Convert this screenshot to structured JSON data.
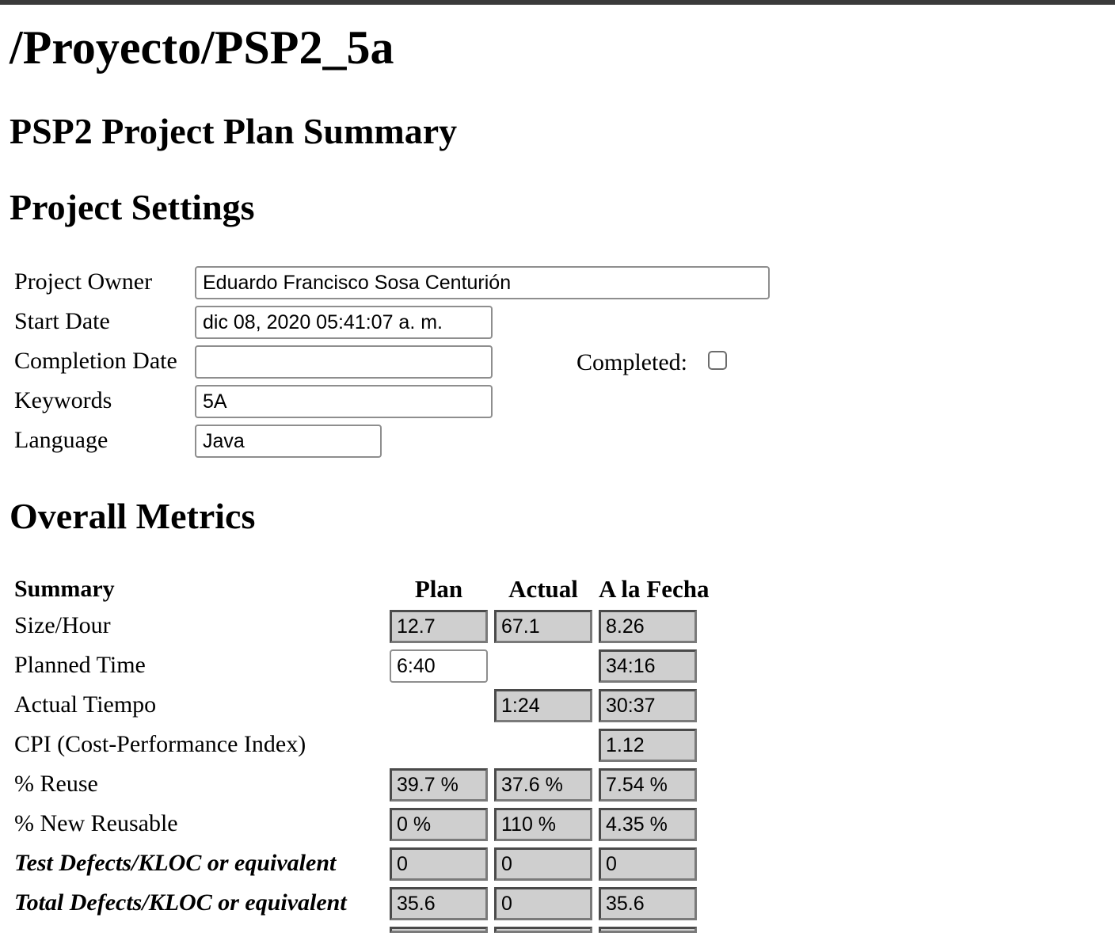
{
  "page": {
    "path_title": "/Proyecto/PSP2_5a",
    "subtitle": "PSP2 Project Plan Summary",
    "settings_heading": "Project Settings",
    "metrics_heading": "Overall Metrics"
  },
  "settings": {
    "owner_label": "Project Owner",
    "owner_value": "Eduardo Francisco Sosa Centurión",
    "start_label": "Start Date",
    "start_value": "dic 08, 2020 05:41:07 a. m.",
    "completion_label": "Completion Date",
    "completion_value": "",
    "completed_label": "Completed:",
    "completed_checked": false,
    "keywords_label": "Keywords",
    "keywords_value": "5A",
    "language_label": "Language",
    "language_value": "Java"
  },
  "metrics": {
    "headers": {
      "summary": "Summary",
      "plan": "Plan",
      "actual": "Actual",
      "to_date": "A la Fecha"
    },
    "rows": [
      {
        "label": "Size/Hour",
        "plan": "12.7",
        "actual": "67.1",
        "to_date": "8.26"
      },
      {
        "label": "Planned Time",
        "plan": "6:40",
        "actual": "",
        "to_date": "34:16"
      },
      {
        "label": "Actual Tiempo",
        "plan": "",
        "actual": "1:24",
        "to_date": "30:37"
      },
      {
        "label": "CPI (Cost-Performance Index)",
        "plan": "",
        "actual": "",
        "to_date": "1.12"
      },
      {
        "label": "% Reuse",
        "plan": "39.7 %",
        "actual": "37.6 %",
        "to_date": "7.54 %"
      },
      {
        "label": "% New Reusable",
        "plan": "0 %",
        "actual": "110 %",
        "to_date": "4.35 %"
      },
      {
        "label": "Test Defects/KLOC or equivalent",
        "plan": "0",
        "actual": "0",
        "to_date": "0"
      },
      {
        "label": "Total Defects/KLOC or equivalent",
        "plan": "35.6",
        "actual": "0",
        "to_date": "35.6"
      }
    ]
  }
}
